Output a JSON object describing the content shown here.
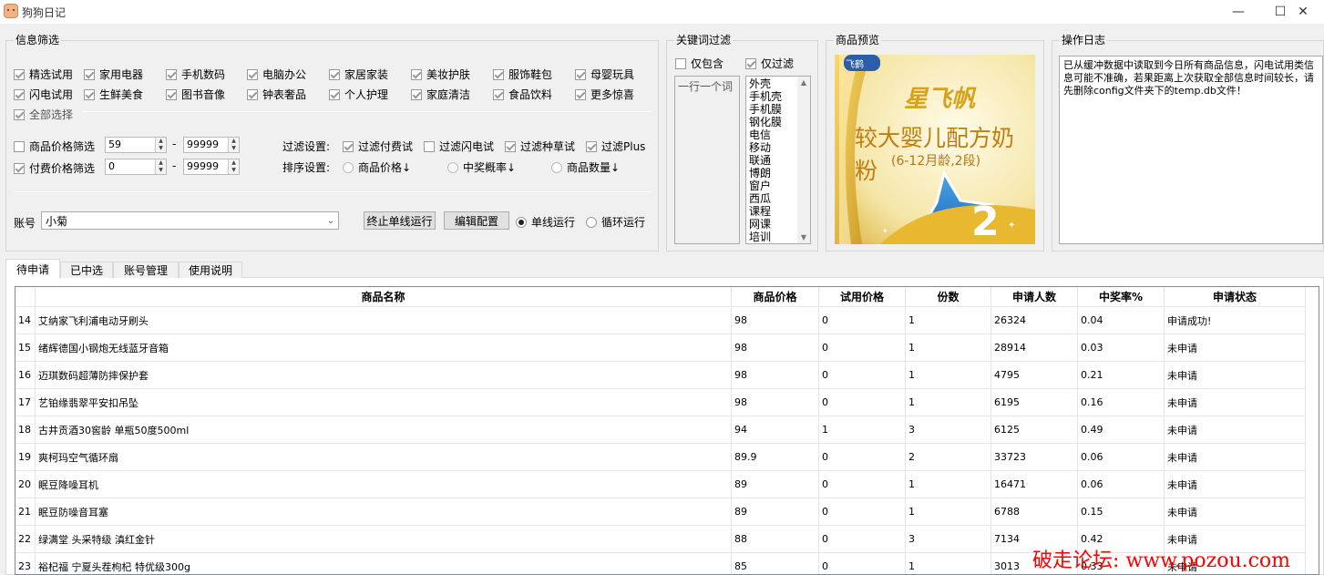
{
  "window": {
    "title": "狗狗日记",
    "minimize": "—",
    "maximize": "☐",
    "close": "✕"
  },
  "filter": {
    "title": "信息筛选",
    "categories": [
      {
        "label": "精选试用",
        "checked": true
      },
      {
        "label": "家用电器",
        "checked": true
      },
      {
        "label": "手机数码",
        "checked": true
      },
      {
        "label": "电脑办公",
        "checked": true
      },
      {
        "label": "家居家装",
        "checked": true
      },
      {
        "label": "美妆护肤",
        "checked": true
      },
      {
        "label": "服饰鞋包",
        "checked": true
      },
      {
        "label": "母婴玩具",
        "checked": true
      },
      {
        "label": "闪电试用",
        "checked": true
      },
      {
        "label": "生鲜美食",
        "checked": true
      },
      {
        "label": "图书音像",
        "checked": true
      },
      {
        "label": "钟表奢品",
        "checked": true
      },
      {
        "label": "个人护理",
        "checked": true
      },
      {
        "label": "家庭清洁",
        "checked": true
      },
      {
        "label": "食品饮料",
        "checked": true
      },
      {
        "label": "更多惊喜",
        "checked": true
      }
    ],
    "select_all": "全部选择",
    "price_filter": {
      "label": "商品价格筛选",
      "min": "59",
      "max": "99999",
      "dash": "-"
    },
    "paid_filter": {
      "label": "付费价格筛选",
      "min": "0",
      "max": "99999",
      "dash": "-"
    },
    "filter_settings": {
      "label": "过滤设置:",
      "options": [
        {
          "label": "过滤付费试",
          "checked": true
        },
        {
          "label": "过滤闪电试",
          "checked": false
        },
        {
          "label": "过滤种草试",
          "checked": true
        },
        {
          "label": "过滤Plus",
          "checked": true
        }
      ]
    },
    "sort_settings": {
      "label": "排序设置:",
      "options": [
        {
          "label": "商品价格↓"
        },
        {
          "label": "中奖概率↓"
        },
        {
          "label": "商品数量↓"
        }
      ]
    },
    "account_label": "账号",
    "account_value": "小菊",
    "stop_button": "终止单线运行",
    "edit_button": "编辑配置",
    "single_run": "单线运行",
    "loop_run": "循环运行"
  },
  "keyword": {
    "title": "关键词过滤",
    "only_include": "仅包含",
    "only_filter": "仅过滤",
    "placeholder": "一行一个词",
    "words": [
      "外壳",
      "手机壳",
      "手机膜",
      "钢化膜",
      "电信",
      "移动",
      "联通",
      "博朗",
      "窗户",
      "西瓜",
      "课程",
      "网课",
      "培训"
    ]
  },
  "preview": {
    "title": "商品预览",
    "brand": "星飞帆",
    "product_name": "较大婴儿配方奶粉",
    "product_sub": "(6-12月龄,2段)",
    "stage": "2",
    "tag": "飞鹤"
  },
  "log": {
    "title": "操作日志",
    "text": "已从缓冲数据中读取到今日所有商品信息，闪电试用类信息可能不准确，若果距离上次获取全部信息时间较长，请先删除config文件夹下的temp.db文件！"
  },
  "tabs": [
    "待申请",
    "已中选",
    "账号管理",
    "使用说明"
  ],
  "table": {
    "columns": [
      "商品名称",
      "商品价格",
      "试用价格",
      "份数",
      "申请人数",
      "中奖率%",
      "申请状态"
    ],
    "rows": [
      [
        "14",
        "艾纳家飞利浦电动牙刷头",
        "98",
        "0",
        "1",
        "26324",
        "0.04",
        "申请成功!"
      ],
      [
        "15",
        "绪辉德国小钢炮无线蓝牙音箱",
        "98",
        "0",
        "1",
        "28914",
        "0.03",
        "未申请"
      ],
      [
        "16",
        "迈琪数码超薄防摔保护套",
        "98",
        "0",
        "1",
        "4795",
        "0.21",
        "未申请"
      ],
      [
        "17",
        "艺铂缘翡翠平安扣吊坠",
        "98",
        "0",
        "1",
        "6195",
        "0.16",
        "未申请"
      ],
      [
        "18",
        "古井贡酒30窖龄 单瓶50度500ml",
        "94",
        "1",
        "3",
        "6125",
        "0.49",
        "未申请"
      ],
      [
        "19",
        "爽柯玛空气循环扇",
        "89.9",
        "0",
        "2",
        "33723",
        "0.06",
        "未申请"
      ],
      [
        "20",
        "眠豆降噪耳机",
        "89",
        "0",
        "1",
        "16471",
        "0.06",
        "未申请"
      ],
      [
        "21",
        "眠豆防噪音耳塞",
        "89",
        "0",
        "1",
        "6788",
        "0.15",
        "未申请"
      ],
      [
        "22",
        "绿满堂 头采特级 滇红金针",
        "88",
        "0",
        "3",
        "7134",
        "0.42",
        "未申请"
      ],
      [
        "23",
        "裕杞福 宁夏头茬枸杞 特优级300g",
        "85",
        "0",
        "1",
        "3013",
        "0.33",
        "未申请"
      ]
    ]
  },
  "watermark": "破走论坛: www.pozou.com",
  "colors": {
    "accent": "#0078d7",
    "watermark": "#ff0000"
  }
}
